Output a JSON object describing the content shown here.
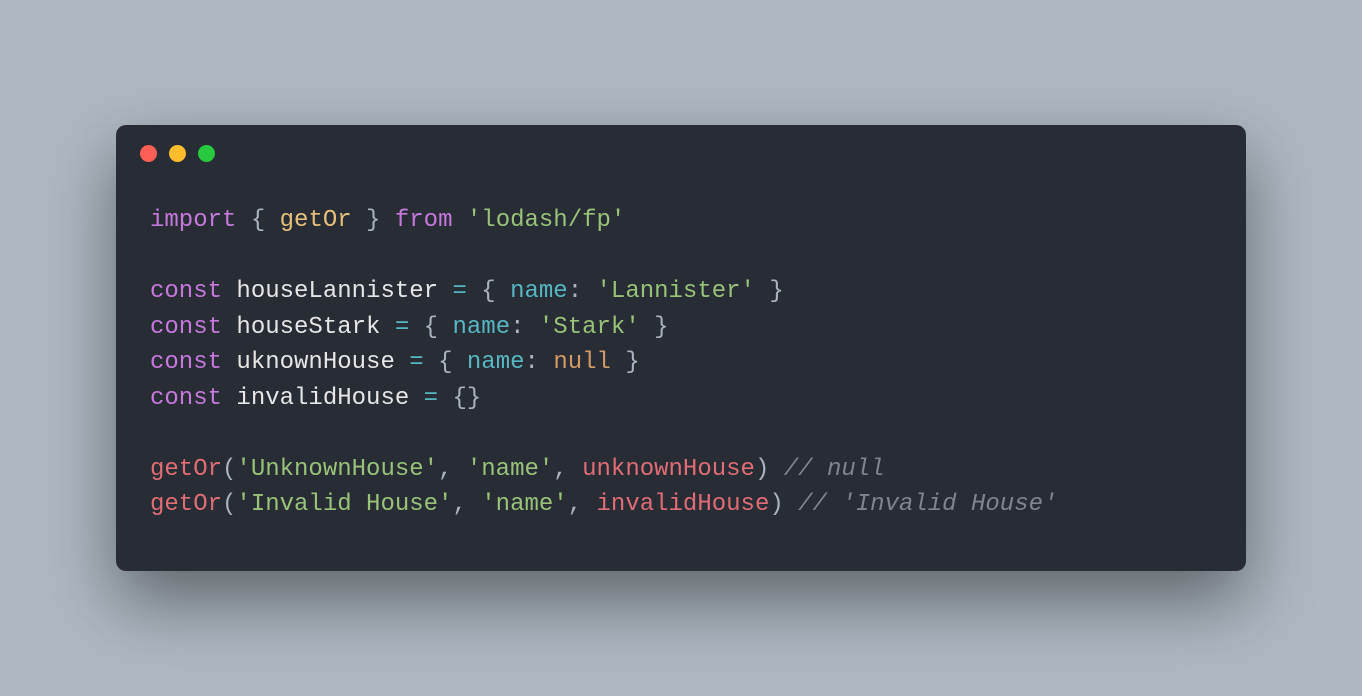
{
  "titlebar": {
    "buttons": [
      "close",
      "minimize",
      "zoom"
    ]
  },
  "code": {
    "lines": [
      {
        "t": [
          {
            "c": "kw",
            "v": "import"
          },
          {
            "c": "punc",
            "v": " { "
          },
          {
            "c": "fn",
            "v": "getOr"
          },
          {
            "c": "punc",
            "v": " } "
          },
          {
            "c": "kw",
            "v": "from"
          },
          {
            "c": "punc",
            "v": " "
          },
          {
            "c": "str",
            "v": "'lodash/fp'"
          }
        ]
      },
      {
        "t": [
          {
            "c": "punc",
            "v": " "
          }
        ]
      },
      {
        "t": [
          {
            "c": "kw",
            "v": "const"
          },
          {
            "c": "punc",
            "v": " "
          },
          {
            "c": "white",
            "v": "houseLannister"
          },
          {
            "c": "punc",
            "v": " "
          },
          {
            "c": "op",
            "v": "="
          },
          {
            "c": "punc",
            "v": " { "
          },
          {
            "c": "prop",
            "v": "name"
          },
          {
            "c": "punc",
            "v": ": "
          },
          {
            "c": "str",
            "v": "'Lannister'"
          },
          {
            "c": "punc",
            "v": " }"
          }
        ]
      },
      {
        "t": [
          {
            "c": "kw",
            "v": "const"
          },
          {
            "c": "punc",
            "v": " "
          },
          {
            "c": "white",
            "v": "houseStark"
          },
          {
            "c": "punc",
            "v": " "
          },
          {
            "c": "op",
            "v": "="
          },
          {
            "c": "punc",
            "v": " { "
          },
          {
            "c": "prop",
            "v": "name"
          },
          {
            "c": "punc",
            "v": ": "
          },
          {
            "c": "str",
            "v": "'Stark'"
          },
          {
            "c": "punc",
            "v": " }"
          }
        ]
      },
      {
        "t": [
          {
            "c": "kw",
            "v": "const"
          },
          {
            "c": "punc",
            "v": " "
          },
          {
            "c": "white",
            "v": "uknownHouse"
          },
          {
            "c": "punc",
            "v": " "
          },
          {
            "c": "op",
            "v": "="
          },
          {
            "c": "punc",
            "v": " { "
          },
          {
            "c": "prop",
            "v": "name"
          },
          {
            "c": "punc",
            "v": ": "
          },
          {
            "c": "null",
            "v": "null"
          },
          {
            "c": "punc",
            "v": " }"
          }
        ]
      },
      {
        "t": [
          {
            "c": "kw",
            "v": "const"
          },
          {
            "c": "punc",
            "v": " "
          },
          {
            "c": "white",
            "v": "invalidHouse"
          },
          {
            "c": "punc",
            "v": " "
          },
          {
            "c": "op",
            "v": "="
          },
          {
            "c": "punc",
            "v": " {}"
          }
        ]
      },
      {
        "t": [
          {
            "c": "punc",
            "v": " "
          }
        ]
      },
      {
        "t": [
          {
            "c": "fncall",
            "v": "getOr"
          },
          {
            "c": "punc",
            "v": "("
          },
          {
            "c": "str",
            "v": "'UnknownHouse'"
          },
          {
            "c": "punc",
            "v": ", "
          },
          {
            "c": "str",
            "v": "'name'"
          },
          {
            "c": "punc",
            "v": ", "
          },
          {
            "c": "fncall",
            "v": "unknownHouse"
          },
          {
            "c": "punc",
            "v": ") "
          },
          {
            "c": "cmt",
            "v": "// null"
          }
        ]
      },
      {
        "t": [
          {
            "c": "fncall",
            "v": "getOr"
          },
          {
            "c": "punc",
            "v": "("
          },
          {
            "c": "str",
            "v": "'Invalid House'"
          },
          {
            "c": "punc",
            "v": ", "
          },
          {
            "c": "str",
            "v": "'name'"
          },
          {
            "c": "punc",
            "v": ", "
          },
          {
            "c": "fncall",
            "v": "invalidHouse"
          },
          {
            "c": "punc",
            "v": ") "
          },
          {
            "c": "cmt",
            "v": "// 'Invalid House'"
          }
        ]
      }
    ]
  }
}
